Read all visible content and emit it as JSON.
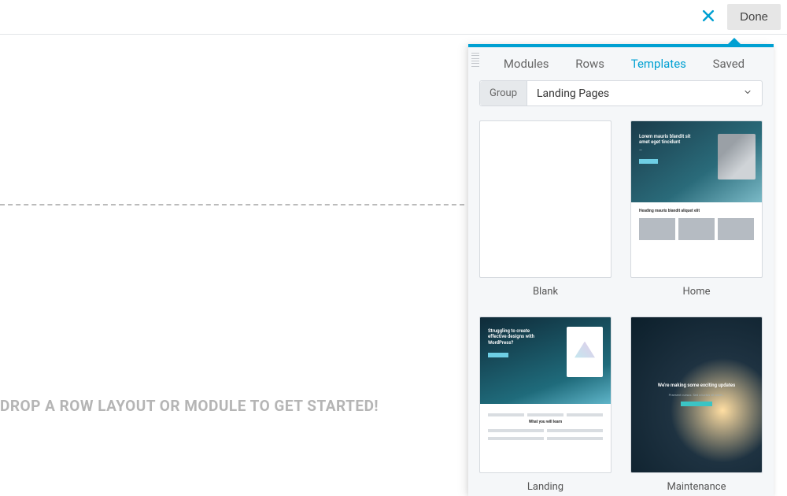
{
  "toolbar": {
    "done_label": "Done"
  },
  "canvas": {
    "drop_message": "DROP A ROW LAYOUT OR MODULE TO GET STARTED!"
  },
  "panel": {
    "tabs": [
      {
        "id": "modules",
        "label": "Modules"
      },
      {
        "id": "rows",
        "label": "Rows"
      },
      {
        "id": "templates",
        "label": "Templates"
      },
      {
        "id": "saved",
        "label": "Saved"
      }
    ],
    "active_tab": "templates",
    "group_label": "Group",
    "group_value": "Landing Pages",
    "templates": [
      {
        "id": "blank",
        "label": "Blank"
      },
      {
        "id": "home",
        "label": "Home"
      },
      {
        "id": "landing",
        "label": "Landing"
      },
      {
        "id": "maintenance",
        "label": "Maintenance"
      }
    ],
    "preview_strings": {
      "home_hero_line1": "Lorem mauris blandit sit",
      "home_hero_line2": "amet eget tincidunt",
      "home_sub_heading": "Heading mauris blandit aliquet elit",
      "landing_hero": "Struggling to create effective designs with WordPress?",
      "landing_sub": "What you will learn",
      "maintenance_title": "We're making some exciting updates"
    }
  },
  "colors": {
    "accent": "#00a0d2"
  }
}
